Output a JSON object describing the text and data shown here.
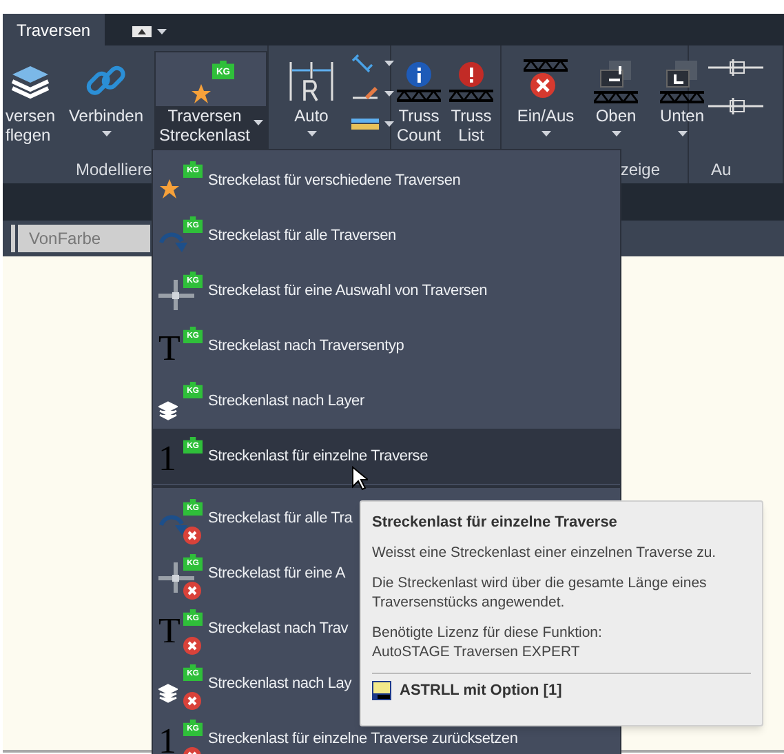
{
  "tabs": [
    {
      "label": "Traversen",
      "selected": true
    }
  ],
  "ribbon": {
    "groups": [
      {
        "label": "Modelliere",
        "buttons": [
          {
            "label": "versen\nflegen",
            "dropdown": false,
            "pressed": false
          },
          {
            "label": "Verbinden",
            "dropdown": true,
            "pressed": false
          },
          {
            "label": "Traversen\nStreckenlast",
            "dropdown": true,
            "pressed": true,
            "badge": "KG"
          }
        ]
      },
      {
        "buttons": [
          {
            "label": "Auto",
            "dropdown": true,
            "pressed": false
          }
        ]
      },
      {
        "buttons": [
          {
            "label": "Truss\nCount",
            "dropdown": false,
            "pressed": false
          },
          {
            "label": "Truss\nList",
            "dropdown": false,
            "pressed": false
          }
        ]
      },
      {
        "label": "zeige",
        "buttons": [
          {
            "label": "Ein/Aus",
            "dropdown": true,
            "pressed": false
          },
          {
            "label": "Oben",
            "dropdown": true,
            "pressed": false
          },
          {
            "label": "Unten",
            "dropdown": true,
            "pressed": false
          }
        ]
      },
      {
        "label": "Au"
      }
    ]
  },
  "toolbar": {
    "color_field": "VonFarbe"
  },
  "menu": {
    "sections": [
      {
        "kind": "assign",
        "items": [
          {
            "label": "Streckelast für verschiedene Traversen",
            "badge": "KG",
            "selected": false
          },
          {
            "label": "Streckelast für alle Traversen",
            "badge": "KG",
            "selected": false
          },
          {
            "label": "Streckelast für eine Auswahl von Traversen",
            "badge": "KG",
            "selected": false
          },
          {
            "label": "Streckelast nach Traversentyp",
            "badge": "KG",
            "glyph": "T",
            "selected": false
          },
          {
            "label": "Streckenlast nach Layer",
            "badge": "KG",
            "selected": false
          },
          {
            "label": "Streckenlast für einzelne Traverse",
            "badge": "KG",
            "glyph": "1",
            "selected": true
          }
        ]
      },
      {
        "kind": "reset",
        "items": [
          {
            "label": "Streckelast für alle Tra",
            "badge": "KG",
            "selected": false
          },
          {
            "label": "Streckelast für eine A",
            "badge": "KG",
            "selected": false
          },
          {
            "label": "Streckelast nach Trav",
            "badge": "KG",
            "glyph": "T",
            "selected": false
          },
          {
            "label": "Streckenlast nach Lay",
            "badge": "KG",
            "selected": false
          },
          {
            "label": "Streckenlast für einzelne Traverse zurücksetzen",
            "badge": "KG",
            "glyph": "1",
            "selected": false
          }
        ]
      }
    ]
  },
  "tooltip": {
    "title": "Streckenlast für einzelne Traverse",
    "paragraphs": [
      "Weisst eine Streckenlast einer einzelnen Traverse zu.",
      "Die Streckenlast wird über die gesamte Länge eines Traversenstücks angewendet.",
      "Benötigte Lizenz für diese Funktion:\nAutoSTAGE Traversen EXPERT"
    ],
    "command": "ASTRLL mit Option [1]"
  }
}
